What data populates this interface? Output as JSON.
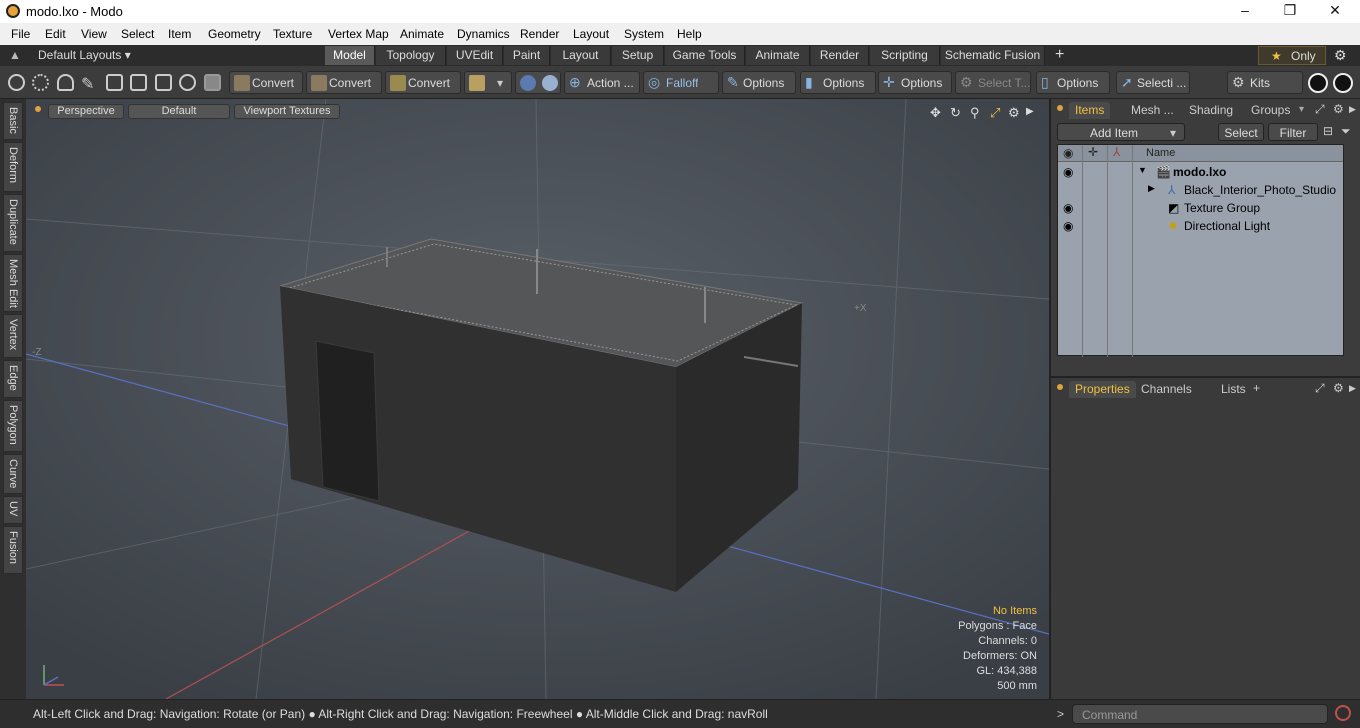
{
  "window": {
    "title": "modo.lxo - Modo",
    "minimize": "–",
    "maximize": "❐",
    "close": "✕"
  },
  "menu": [
    "File",
    "Edit",
    "View",
    "Select",
    "Item",
    "Geometry",
    "Texture",
    "Vertex Map",
    "Animate",
    "Dynamics",
    "Render",
    "Layout",
    "System",
    "Help"
  ],
  "layout_selector": "Default Layouts ▾",
  "layout_tabs": [
    "Model",
    "Topology",
    "UVEdit",
    "Paint",
    "Layout",
    "Setup",
    "Game Tools",
    "Animate",
    "Render",
    "Scripting",
    "Schematic Fusion"
  ],
  "active_layout_tab": "Model",
  "only_button": {
    "star": "★",
    "label": "Only"
  },
  "toolbar": {
    "convert1": "Convert",
    "convert2": "Convert",
    "convert3": "Convert",
    "action": "Action ...",
    "falloff": "Falloff",
    "options1": "Options",
    "options2": "Options",
    "options3": "Options",
    "select_t": "Select T...",
    "options4": "Options",
    "selecti": "Selecti ...",
    "kits": "Kits"
  },
  "left_tabs": [
    "Basic",
    "Deform",
    "Duplicate",
    "Mesh Edit",
    "Vertex",
    "Edge",
    "Polygon",
    "Curve",
    "UV",
    "Fusion"
  ],
  "viewport": {
    "view_mode": "Perspective",
    "shading": "Default",
    "textures": "Viewport Textures",
    "axis_neg_z": "-Z",
    "axis_pos_x": "+X",
    "info": {
      "selection": "No Items",
      "polygons": "Polygons : Face",
      "channels": "Channels: 0",
      "deformers": "Deformers: ON",
      "gl": "GL: 434,388",
      "scale": "500 mm"
    }
  },
  "items_panel": {
    "tabs": [
      "Items",
      "Mesh ...",
      "Shading",
      "Groups"
    ],
    "active_tab": "Items",
    "add_item": "Add Item",
    "select": "Select",
    "filter": "Filter",
    "column_name": "Name",
    "tree": [
      {
        "name": "modo.lxo",
        "eye": true
      },
      {
        "name": "Black_Interior_Photo_Studio",
        "eye": false
      },
      {
        "name": "Texture Group",
        "eye": true
      },
      {
        "name": "Directional Light",
        "eye": true
      }
    ]
  },
  "properties_panel": {
    "tabs": [
      "Properties",
      "Channels",
      "Lists"
    ],
    "active_tab": "Properties"
  },
  "status": {
    "hint": "Alt-Left Click and Drag: Navigation: Rotate (or Pan) ● Alt-Right Click and Drag: Navigation: Freewheel ● Alt-Middle Click and Drag: navRoll",
    "command_placeholder": "Command"
  },
  "colors": {
    "accent": "#f0c040",
    "viewport_bg": "#4a5058",
    "panel_bg": "#3c3c3c",
    "items_bg": "#9aa3ad"
  }
}
